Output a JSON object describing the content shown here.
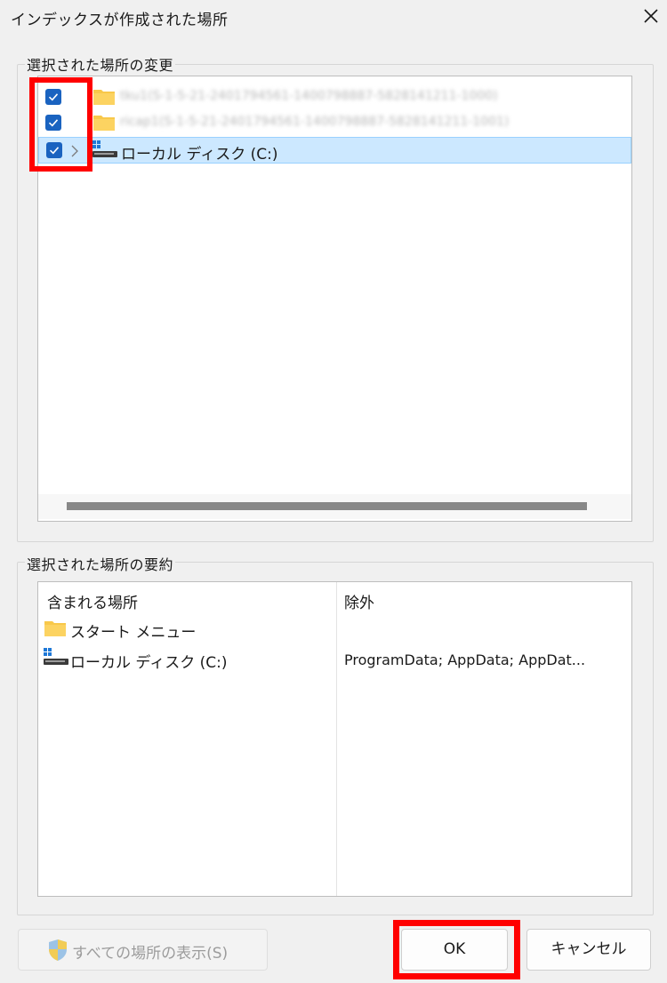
{
  "window": {
    "title": "インデックスが作成された場所"
  },
  "change_section": {
    "label": "選択された場所の変更",
    "tree_items": [
      {
        "label": "tku1(S-1-5-21-2401794561-1400798887-5828141211-1000)",
        "checked": true,
        "icon": "folder-icon",
        "blurred": true
      },
      {
        "label": "ricap1(S-1-5-21-2401794561-1400798887-5828141211-1001)",
        "checked": true,
        "icon": "folder-icon",
        "blurred": true
      },
      {
        "label": "ローカル ディスク (C:)",
        "checked": true,
        "icon": "drive-icon",
        "expandable": true,
        "selected": true
      }
    ]
  },
  "summary_section": {
    "label": "選択された場所の要約",
    "columns": [
      "含まれる場所",
      "除外"
    ],
    "rows": [
      {
        "location": "スタート メニュー",
        "icon": "folder-icon",
        "excluded": ""
      },
      {
        "location": "ローカル ディスク (C:)",
        "icon": "drive-icon",
        "excluded": "ProgramData; AppData; AppDat..."
      }
    ]
  },
  "buttons": {
    "show_all": "すべての場所の表示(S)",
    "ok": "OK",
    "cancel": "キャンセル"
  },
  "colors": {
    "checkbox": "#1a63c0",
    "selection": "#cce8ff",
    "highlight_box": "#ff0000",
    "folder": "#f8c84a"
  }
}
